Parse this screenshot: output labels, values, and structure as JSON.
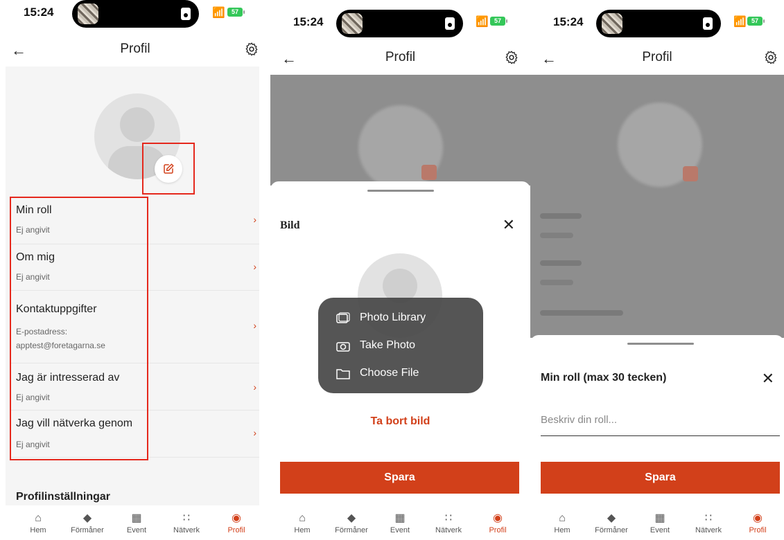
{
  "status": {
    "time": "15:24",
    "battery": "57"
  },
  "header": {
    "title": "Profil"
  },
  "profile_rows": [
    {
      "title": "Min roll",
      "sub": "Ej angivit"
    },
    {
      "title": "Om mig",
      "sub": "Ej angivit"
    },
    {
      "title": "Kontaktuppgifter",
      "sub1": "E-postadress:",
      "sub2": "apptest@foretagarna.se"
    },
    {
      "title": "Jag är intresserad av",
      "sub": "Ej angivit"
    },
    {
      "title": "Jag vill nätverka genom",
      "sub": "Ej angivit"
    }
  ],
  "section": {
    "title": "Profilinställningar"
  },
  "tabs": [
    {
      "label": "Hem",
      "icon": "home-icon"
    },
    {
      "label": "Förmåner",
      "icon": "diamond-icon"
    },
    {
      "label": "Event",
      "icon": "calendar-icon"
    },
    {
      "label": "Nätverk",
      "icon": "network-icon"
    },
    {
      "label": "Profil",
      "icon": "profile-icon"
    }
  ],
  "image_sheet": {
    "title": "Bild",
    "menu": [
      "Photo Library",
      "Take Photo",
      "Choose File"
    ],
    "remove_label": "Ta bort bild",
    "save_label": "Spara"
  },
  "role_sheet": {
    "title": "Min roll (max 30 tecken)",
    "placeholder": "Beskriv din roll...",
    "value": "",
    "save_label": "Spara"
  },
  "colors": {
    "accent": "#d2401a",
    "highlight": "#e5281c",
    "battery": "#34c759"
  }
}
